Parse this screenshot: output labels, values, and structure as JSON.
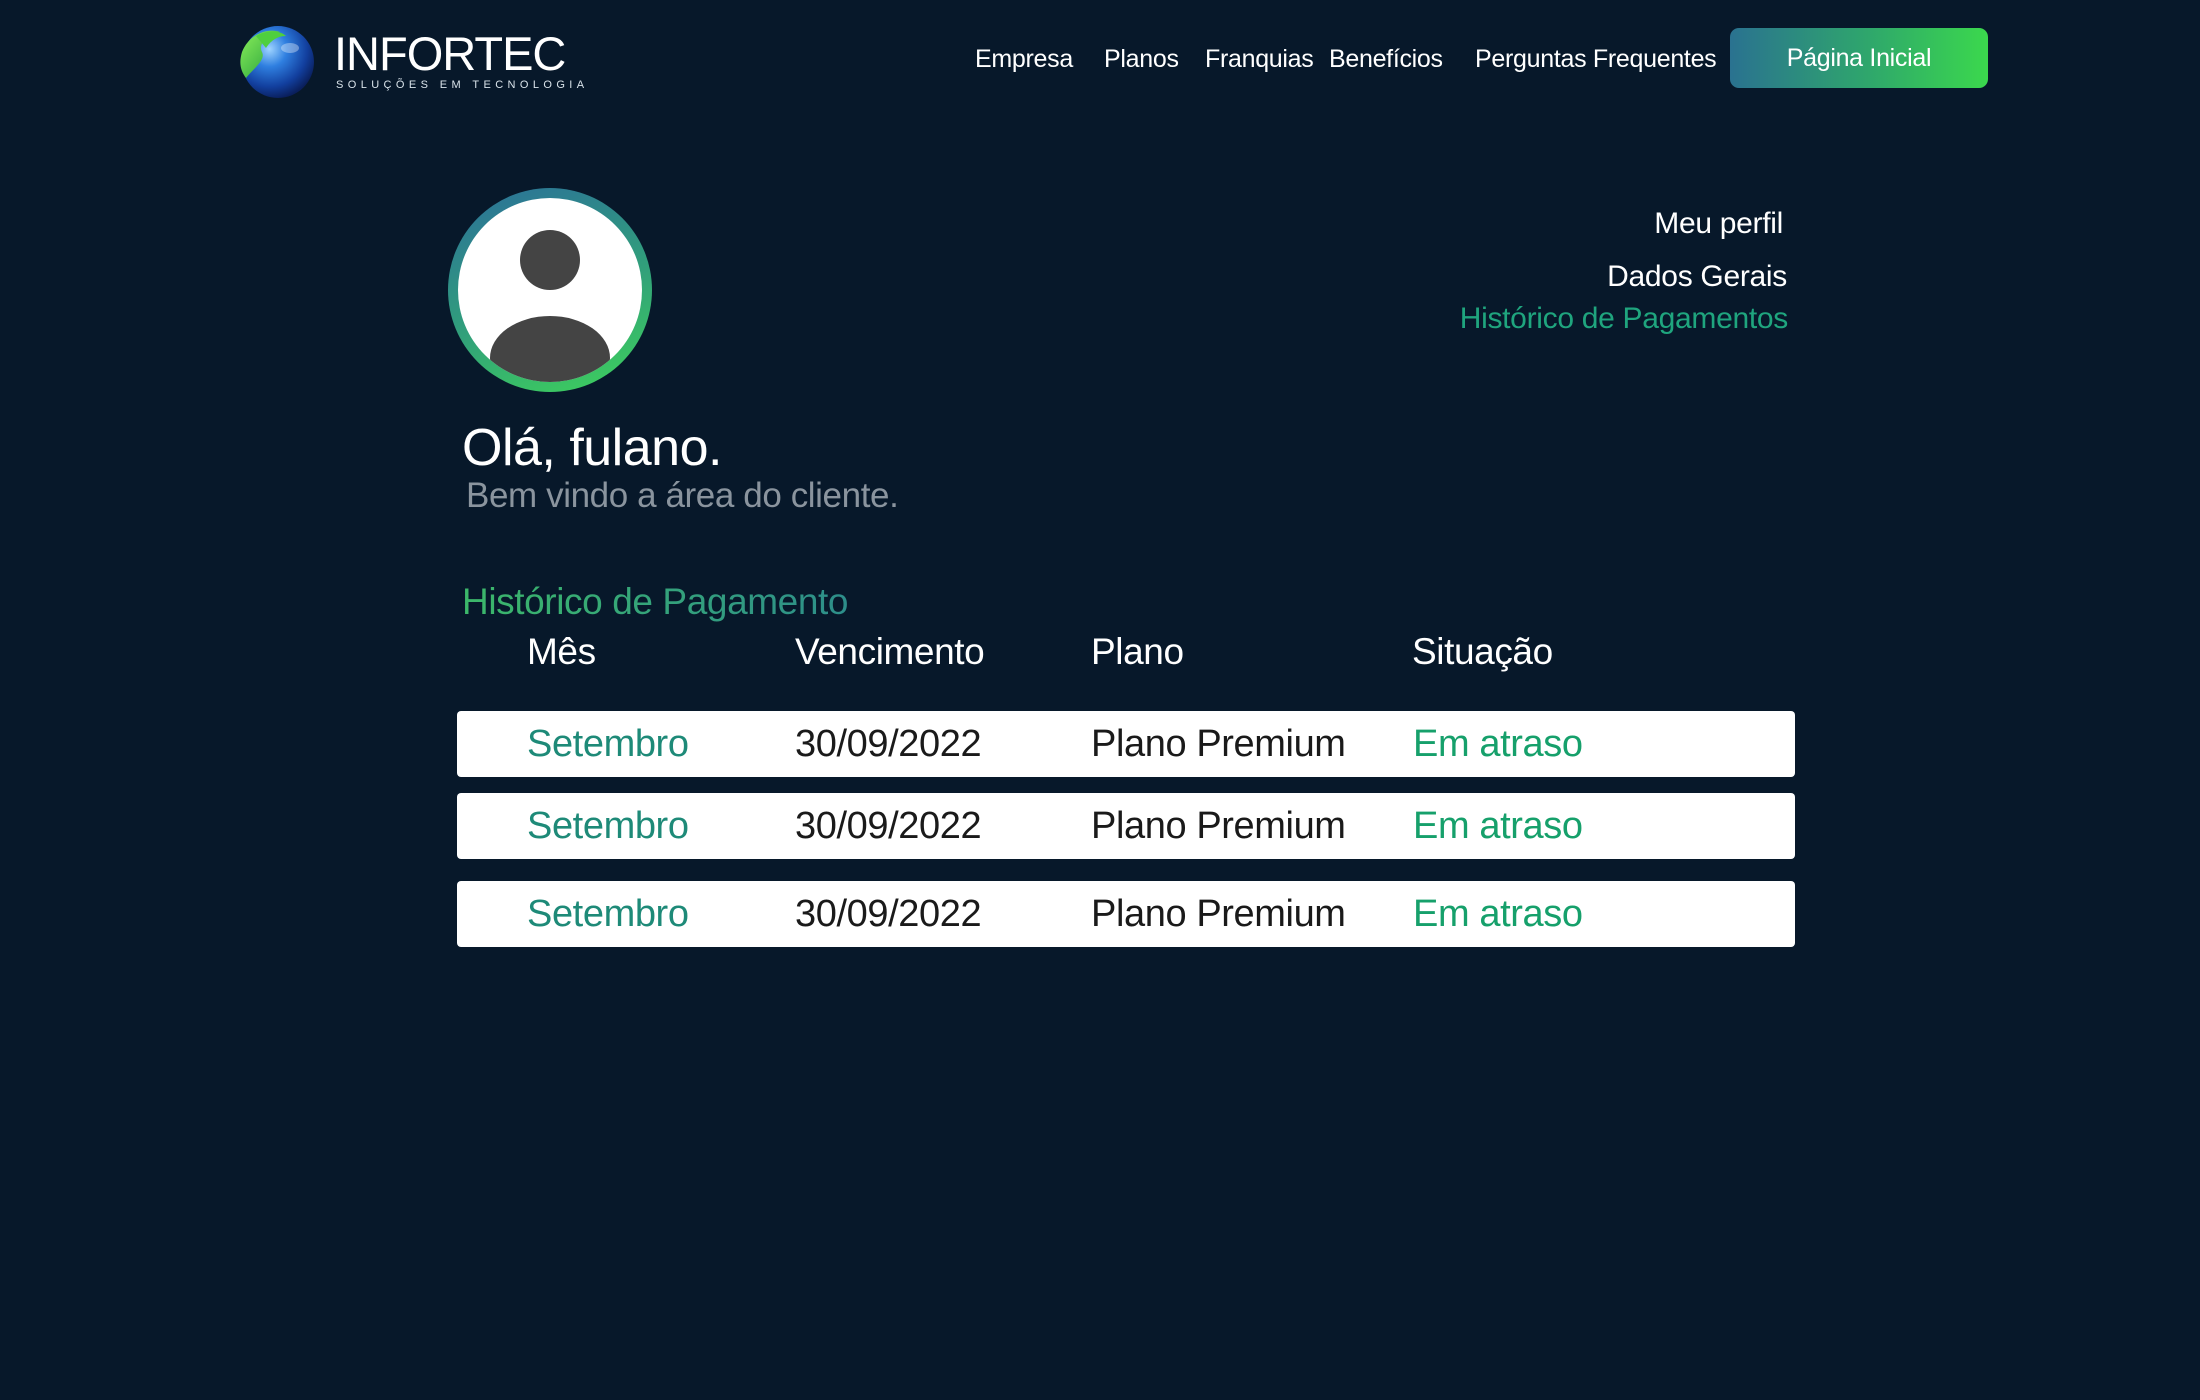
{
  "brand": {
    "name": "INFORTEC",
    "tagline": "SOLUÇÕES EM TECNOLOGIA"
  },
  "nav": {
    "items": [
      {
        "label": "Empresa"
      },
      {
        "label": "Planos"
      },
      {
        "label": "Franquias"
      },
      {
        "label": "Benefícios"
      },
      {
        "label": "Perguntas Frequentes"
      }
    ],
    "cta_label": "Página Inicial"
  },
  "profile_menu": {
    "items": [
      {
        "label": "Meu perfil",
        "active": false
      },
      {
        "label": "Dados Gerais",
        "active": false
      },
      {
        "label": "Histórico de Pagamentos",
        "active": true
      }
    ]
  },
  "user": {
    "greeting": "Olá, fulano.",
    "welcome": "Bem vindo a área do cliente."
  },
  "payments": {
    "title": "Histórico de Pagamento",
    "columns": [
      "Mês",
      "Vencimento",
      "Plano",
      "Situação"
    ],
    "rows": [
      {
        "month": "Setembro",
        "due_date": "30/09/2022",
        "plan": "Plano Premium",
        "status": "Em atraso"
      },
      {
        "month": "Setembro",
        "due_date": "30/09/2022",
        "plan": "Plano Premium",
        "status": "Em atraso"
      },
      {
        "month": "Setembro",
        "due_date": "30/09/2022",
        "plan": "Plano Premium",
        "status": "Em atraso"
      }
    ]
  },
  "colors": {
    "background": "#07182a",
    "accent_green": "#16a06b",
    "accent_teal": "#1e8a78",
    "cta_gradient_start": "#2a7290",
    "cta_gradient_end": "#3bd84d",
    "muted_text": "#8a949e"
  },
  "icons": {
    "logo": "globe-icon",
    "avatar": "user-avatar-icon"
  }
}
